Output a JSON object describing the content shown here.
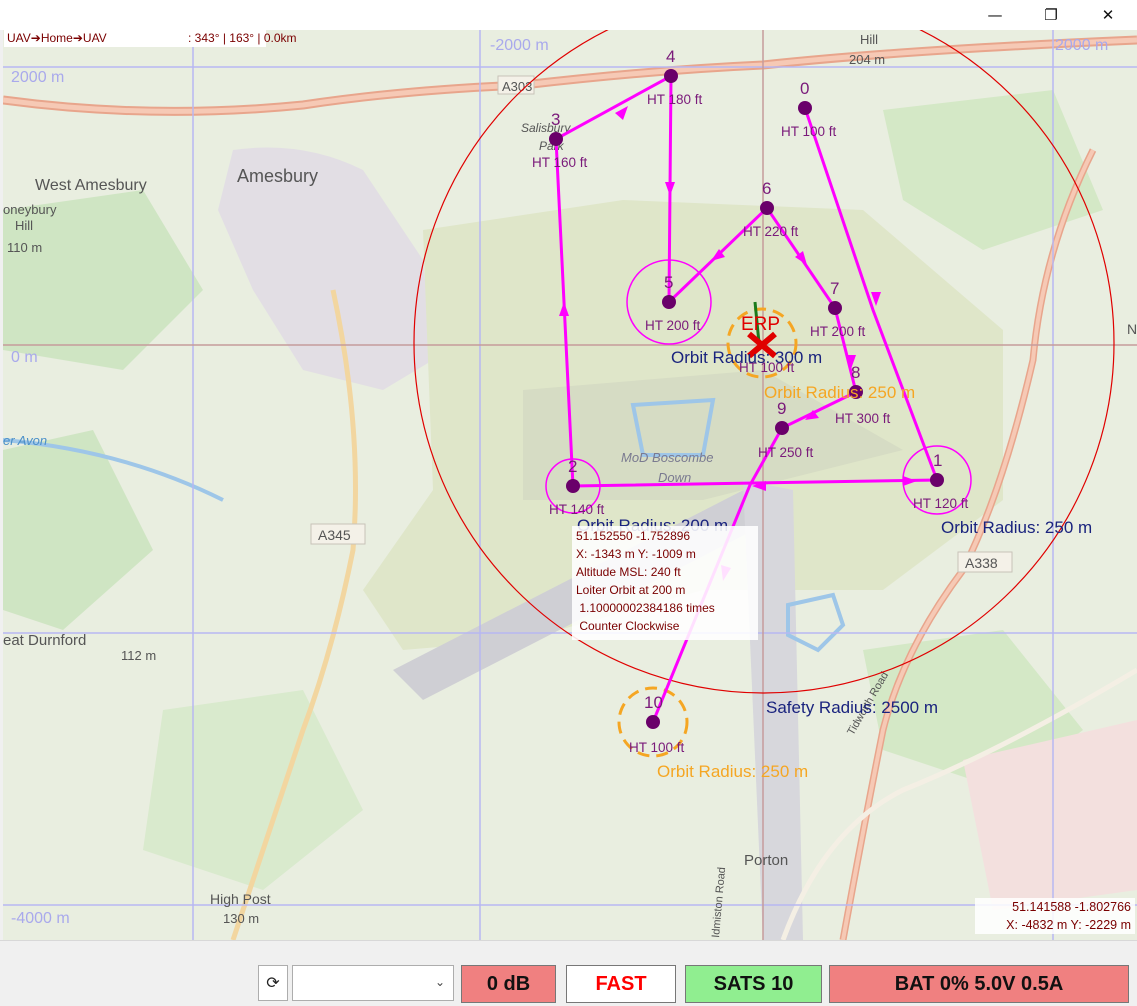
{
  "window": {
    "minimize": "—",
    "restore": "❐",
    "close": "✕"
  },
  "info_bar": {
    "route": "UAV➔Home➔UAV",
    "bearing": ": 343° | 163° | 0.0km"
  },
  "map": {
    "grid_labels": [
      "-2000 m",
      "2000 m",
      "2000 m",
      "0 m",
      "-4000 m"
    ],
    "place_labels": [
      "West Amesbury",
      "Amesbury",
      "oneybury",
      "Hill",
      "110 m",
      "Salisbury",
      "Park",
      "MoD Boscombe",
      "Down",
      "A345",
      "A338",
      "A303",
      "Hill",
      "204 m",
      "eat Durnford",
      "112 m",
      "Porton",
      "High Post",
      "130 m",
      "er Avon",
      "N",
      "Tidworth Road",
      "Idmiston Road"
    ],
    "waypoints": [
      {
        "id": "0",
        "label": "HT 100 ft"
      },
      {
        "id": "1",
        "label": "HT 120 ft",
        "orbit": "Orbit Radius: 250 m"
      },
      {
        "id": "2",
        "label": "HT 140 ft",
        "orbit": "Orbit Radius: 200 m"
      },
      {
        "id": "3",
        "label": "HT 160 ft"
      },
      {
        "id": "4",
        "label": "HT 180 ft"
      },
      {
        "id": "5",
        "label": "HT 200 ft",
        "orbit": "Orbit Radius: 300 m"
      },
      {
        "id": "6",
        "label": "HT 220 ft"
      },
      {
        "id": "7",
        "label": "HT 200 ft"
      },
      {
        "id": "8",
        "label": "HT 300 ft"
      },
      {
        "id": "9",
        "label": "HT 250 ft"
      },
      {
        "id": "10",
        "label": "HT 100 ft",
        "orbit": "Orbit Radius: 250 m"
      }
    ],
    "erp": {
      "label": "ERP",
      "ht": "HT 100 ft",
      "orbit": "Orbit Radius: 250 m"
    },
    "safety_radius": "Safety Radius: 2500 m",
    "colors": {
      "route": "#ff00ff",
      "waypoint": "#6a006a",
      "safety": "#e00000",
      "orbit_orange": "#f5a623",
      "orbit_label_blue": "#1a237e",
      "grid": "#b3b3f0",
      "axis": "#c9a0a0"
    }
  },
  "popup": {
    "lines": [
      "51.152550 -1.752896",
      "X: -1343 m Y: -1009 m",
      "Altitude MSL: 240 ft",
      "Loiter Orbit at 200 m",
      " 1.10000002384186 times",
      " Counter Clockwise"
    ]
  },
  "cursor_coords": {
    "latlon": "51.141588 -1.802766",
    "xy": "X: -4832 m Y: -2229 m"
  },
  "bottom": {
    "refresh_icon": "⟳",
    "combo_value": "",
    "combo_arrow": "⌄",
    "db": {
      "label": "0 dB",
      "color": "#f08080"
    },
    "speed": {
      "label": "FAST",
      "color": "#ffffff",
      "text_color": "#ff0000"
    },
    "sats": {
      "label": "SATS 10",
      "color": "#90ee90"
    },
    "battery": {
      "label": "BAT 0% 5.0V 0.5A",
      "color": "#f08080"
    }
  }
}
